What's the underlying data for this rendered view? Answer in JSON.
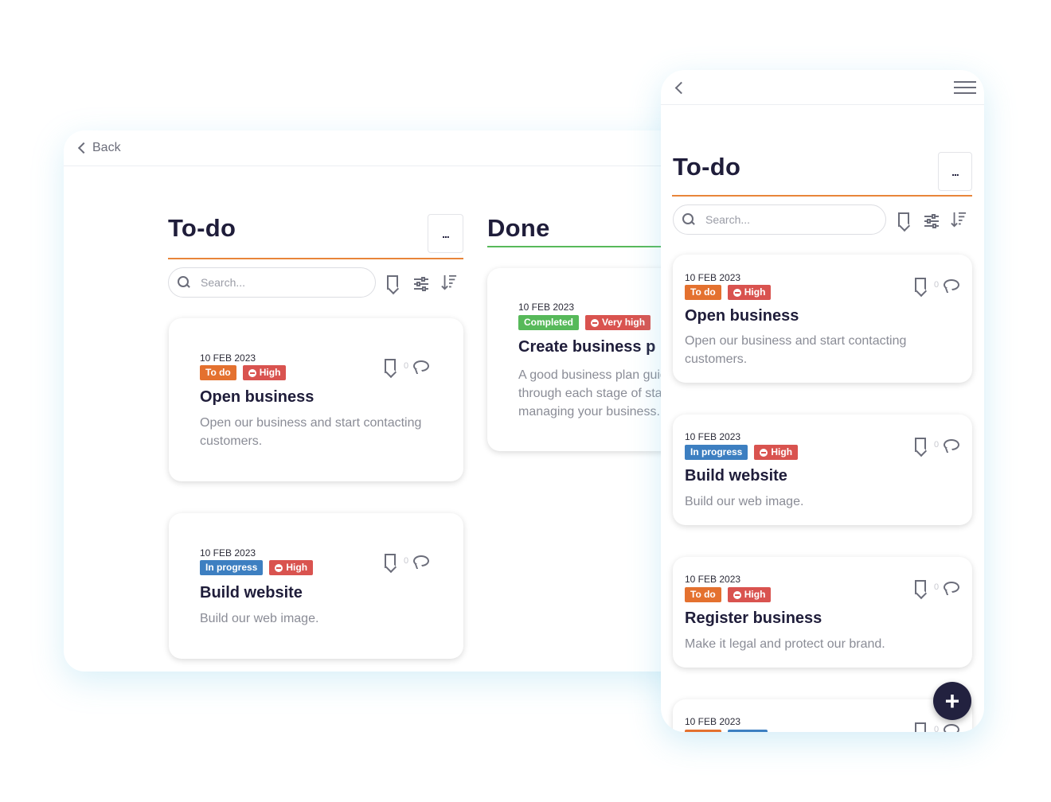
{
  "desktop": {
    "back_label": "Back",
    "todo": {
      "title": "To-do",
      "more": "...",
      "search_placeholder": "Search..."
    },
    "done": {
      "title": "Done"
    },
    "cards_todo": [
      {
        "date": "10 FEB 2023",
        "status": "To do",
        "priority": "High",
        "title": "Open business",
        "desc_1": "Open our business and start contacting",
        "desc_2": "customers.",
        "comments": "0"
      },
      {
        "date": "10 FEB 2023",
        "status": "In progress",
        "priority": "High",
        "title": "Build website",
        "desc_1": "Build our web image.",
        "comments": "0"
      }
    ],
    "cards_done": [
      {
        "date": "10 FEB 2023",
        "status": "Completed",
        "priority": "Very high",
        "title": "Create business p",
        "desc_1": "A good business plan guid",
        "desc_2": "through each stage of sta",
        "desc_3": "managing your business."
      }
    ]
  },
  "mobile": {
    "title": "To-do",
    "more": "...",
    "search_placeholder": "Search...",
    "cards": [
      {
        "date": "10 FEB 2023",
        "status": "To do",
        "priority": "High",
        "title": "Open business",
        "desc_1": "Open our business and start contacting",
        "desc_2": "customers.",
        "comments": "0"
      },
      {
        "date": "10 FEB 2023",
        "status": "In progress",
        "priority": "High",
        "title": "Build website",
        "desc_1": "Build our web image.",
        "comments": "0"
      },
      {
        "date": "10 FEB 2023",
        "status": "To do",
        "priority": "High",
        "title": "Register business",
        "desc_1": "Make it legal and protect our brand.",
        "comments": "0"
      },
      {
        "date": "10 FEB 2023",
        "comments": "0"
      }
    ],
    "fab": "+"
  },
  "colors": {
    "todo_tag": "#e4712f",
    "progress_tag": "#3d7fc1",
    "done_tag": "#57b95a",
    "high_tag": "#d9534f",
    "todo_rule": "#e8853a",
    "done_rule": "#57b95a",
    "fab": "#22213f"
  }
}
